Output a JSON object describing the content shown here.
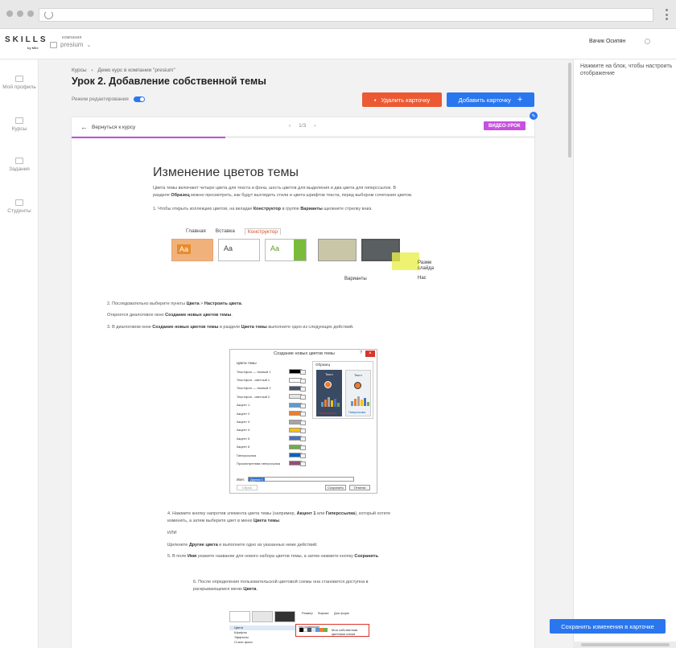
{
  "browser": {
    "url": ""
  },
  "app": {
    "logo": "SKILLS",
    "logo_sub": "by Mile",
    "company_label": "компания",
    "company_name": "presium",
    "user_name": "Вачик Осипян"
  },
  "sidebar": {
    "items": [
      {
        "label": "Мой профиль",
        "icon": "profile-icon"
      },
      {
        "label": "Курсы",
        "icon": "courses-icon"
      },
      {
        "label": "Задания",
        "icon": "tasks-icon"
      },
      {
        "label": "Студенты",
        "icon": "students-icon"
      }
    ]
  },
  "page": {
    "breadcrumb_root": "Курсы",
    "breadcrumb_sep": "›",
    "breadcrumb_current": "Демо курс в компании \"presium\"",
    "title": "Урок 2. Добавление собственной темы",
    "edit_mode_label": "Режим редактирования",
    "edit_mode_on": true,
    "delete_button": "Удалить карточку",
    "add_button": "Добавить карточку",
    "add_icon": "+"
  },
  "card": {
    "back_label": "Вернуться к курсу",
    "pager": "1/3",
    "badge": "ВИДЕО-УРОК",
    "progress": 0.333,
    "heading": "Изменение цветов темы",
    "intro_1": "Цвета темы включают четыре цвета для текста и фона, шесть цветов для выделения и два цвета для гиперссылок. В",
    "intro_2a": "разделе ",
    "intro_2b": "Образец",
    "intro_2c": " можно просмотреть, как будут выглядеть стили и цвета шрифтов текста, перед выбором сочетания цветов.",
    "step1a": "1. Чтобы открыть коллекцию цветов, на вкладке ",
    "step1b": "Конструктор",
    "step1c": " в группе ",
    "step1d": "Варианты",
    "step1e": " щелкните стрелку вниз.",
    "step2a": "2. Последовательно выберите пункты ",
    "step2b": "Цвета",
    "step2c": " > ",
    "step2d": "Настроить цвета",
    "step2e": ".",
    "step2_note_a": "Откроется диалоговое окно ",
    "step2_note_b": "Создание новых цветов темы",
    "step2_note_c": ".",
    "step3a": "3. В диалоговом окне ",
    "step3b": "Создание новых цветов темы",
    "step3c": " в разделе ",
    "step3d": "Цвета темы",
    "step3e": " выполните одно из следующих действий.",
    "step4_1a": "4. Нажмите кнопку напротив элемента цвета темы (например, ",
    "step4_1b": "Акцент 1",
    "step4_1c": " или ",
    "step4_1d": "Гиперссылка",
    "step4_1e": "), который хотите",
    "step4_2a": "изменить, а затем выберите цвет в меню ",
    "step4_2b": "Цвета темы",
    "step4_2c": ".",
    "or": "ИЛИ",
    "other_a": "Щелкните ",
    "other_b": "Другие цвета",
    "other_c": " и выполните одно из указанных ниже действий.",
    "step5a": "5. В поле ",
    "step5b": "Имя",
    "step5c": " укажите название для нового набора цветов темы, а затем нажмите кнопку ",
    "step5d": "Сохранить",
    "step5e": ".",
    "step6_1": "6. После определения пользовательской цветовой схемы она становится доступна в",
    "step6_2a": "раскрывающемся меню ",
    "step6_2b": "Цвета",
    "step6_2c": "."
  },
  "ribbon_fig": {
    "tabs": [
      "Главная",
      "Вставка",
      "Конструктор"
    ],
    "thumb_text": "Aa",
    "group_label": "Варианты",
    "size_label_1": "Разме",
    "size_label_2": "слайда",
    "size_label_3": "Нас"
  },
  "dialog_fig": {
    "title": "Создание новых цветов темы",
    "q": "?",
    "close": "×",
    "left_header": "Цвета темы",
    "right_header": "Образец",
    "rows": [
      {
        "label": "Текст/фон — темный 1",
        "color": "#000000"
      },
      {
        "label": "Текст/фон - светлый 1",
        "color": "#ffffff"
      },
      {
        "label": "Текст/фон — темный 2",
        "color": "#44546a"
      },
      {
        "label": "Текст/фон - светлый 2",
        "color": "#e7e6e6"
      },
      {
        "label": "Акцент 1",
        "color": "#5b9bd5"
      },
      {
        "label": "Акцент 2",
        "color": "#ed7d31"
      },
      {
        "label": "Акцент 3",
        "color": "#a5a5a5"
      },
      {
        "label": "Акцент 4",
        "color": "#ffc000"
      },
      {
        "label": "Акцент 5",
        "color": "#4472c4"
      },
      {
        "label": "Акцент 6",
        "color": "#70ad47"
      },
      {
        "label": "Гиперссылка",
        "color": "#0563c1"
      },
      {
        "label": "Просмотренная гиперссылка",
        "color": "#954f72"
      }
    ],
    "sample_text": "Текст",
    "hyperlink_1": "Гиперссылка",
    "hyperlink_2": "Гиперссылка",
    "name_label": "Имя:",
    "name_value": "Другая 1",
    "reset": "Сброс",
    "save": "Сохранить",
    "cancel": "Отмена"
  },
  "menu_fig": {
    "icons": [
      "Размер",
      "Формат",
      "Для форм"
    ],
    "items": [
      "Цвета",
      "Шрифты",
      "Эффекты",
      "Стили фона"
    ],
    "custom_label": "Настраиваемые",
    "custom_item": "Моя собственная цветовая схема"
  },
  "right_panel": {
    "hint": "Нажмите на блок, чтобы настроить отображение",
    "save_button": "Сохранить изменения в карточке"
  },
  "colors": {
    "accent": "#2a76ee",
    "danger": "#ec5a33",
    "badge": "#c64fe0"
  }
}
